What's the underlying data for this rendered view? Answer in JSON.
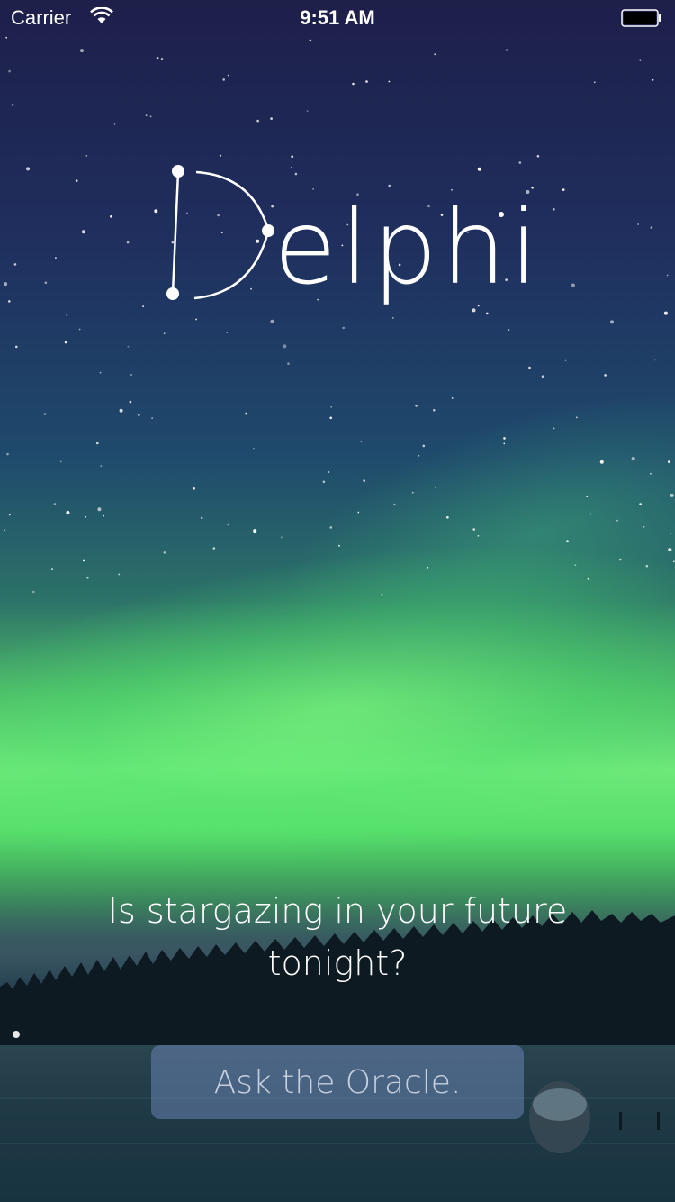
{
  "status_bar": {
    "carrier": "Carrier",
    "time": "9:51 AM",
    "wifi_icon": "wifi-icon",
    "battery_icon": "battery-icon"
  },
  "app": {
    "logo_letter_icon": "constellation-d-icon",
    "logo_text": "elphi"
  },
  "main": {
    "tagline": "Is stargazing in your future tonight?",
    "button_label": "Ask the Oracle."
  },
  "colors": {
    "sky_top": "#1e1f4a",
    "aurora": "#6ee87a",
    "button_bg": "#7891c8",
    "text": "#ffffff"
  }
}
